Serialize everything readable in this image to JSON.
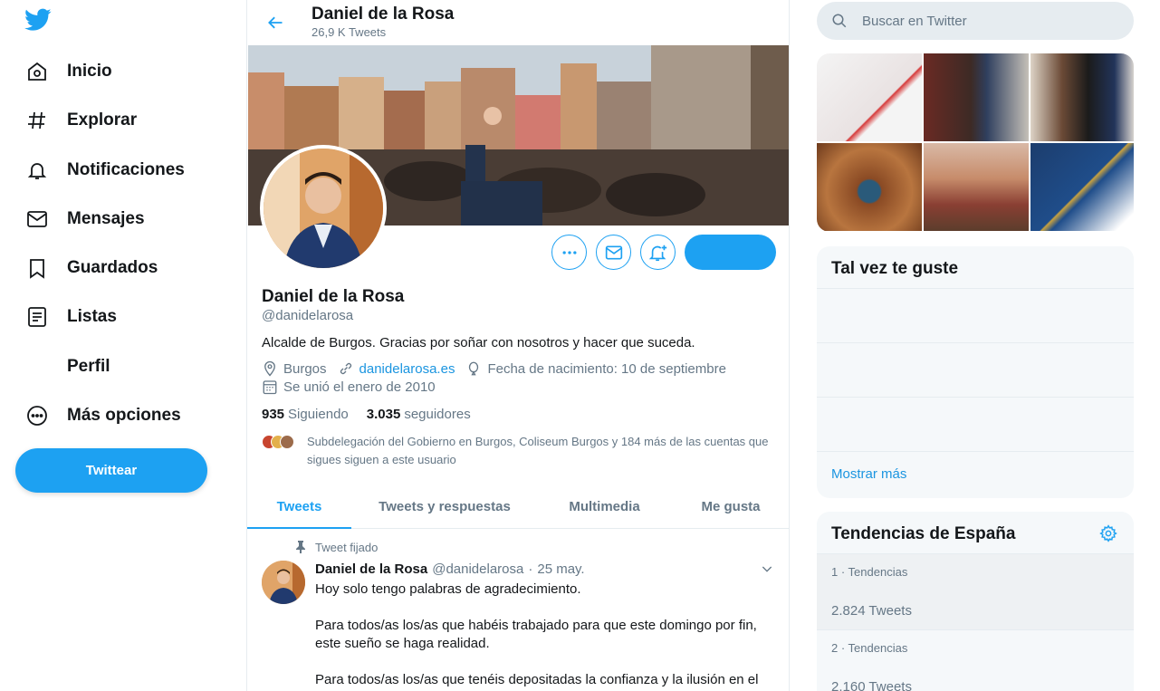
{
  "nav": {
    "items": [
      {
        "label": "Inicio",
        "icon": "home-icon"
      },
      {
        "label": "Explorar",
        "icon": "hashtag-icon"
      },
      {
        "label": "Notificaciones",
        "icon": "bell-icon"
      },
      {
        "label": "Mensajes",
        "icon": "envelope-icon"
      },
      {
        "label": "Guardados",
        "icon": "bookmark-icon"
      },
      {
        "label": "Listas",
        "icon": "list-icon"
      },
      {
        "label": "Perfil",
        "icon": "profile-icon"
      },
      {
        "label": "Más opciones",
        "icon": "more-options-icon"
      }
    ],
    "tweet_button": "Twittear"
  },
  "header": {
    "name": "Daniel de la Rosa",
    "tweet_count": "26,9 K Tweets"
  },
  "profile": {
    "name": "Daniel de la Rosa",
    "handle": "@danidelarosa",
    "bio": "Alcalde de Burgos. Gracias por soñar con nosotros y hacer que suceda.",
    "location": "Burgos",
    "website": "danidelarosa.es",
    "birthday": "Fecha de nacimiento: 10 de septiembre",
    "joined": "Se unió el enero de 2010",
    "following_count": "935",
    "following_label": "Siguiendo",
    "followers_count": "3.035",
    "followers_label": "seguidores",
    "followers_you_know": "Subdelegación del Gobierno en Burgos, Coliseum Burgos y 184 más de las cuentas que sigues siguen a este usuario"
  },
  "tabs": [
    "Tweets",
    "Tweets y respuestas",
    "Multimedia",
    "Me gusta"
  ],
  "tweet": {
    "pinned_label": "Tweet fijado",
    "author": "Daniel de la Rosa",
    "handle": "@danidelarosa",
    "sep": "·",
    "date": "25 may.",
    "paragraphs": [
      "Hoy solo tengo palabras de agradecimiento.",
      "Para todos/as los/as que habéis trabajado para que este domingo por fin, este sueño se haga realidad.",
      "Para todos/as los/as que tenéis depositadas la confianza y la ilusión en el"
    ]
  },
  "search": {
    "placeholder": "Buscar en Twitter"
  },
  "who_to_follow": {
    "title": "Tal vez te guste",
    "show_more": "Mostrar más"
  },
  "trends": {
    "title": "Tendencias de España",
    "items": [
      {
        "meta": "1 · Tendencias",
        "count": "2.824 Tweets"
      },
      {
        "meta": "2 · Tendencias",
        "count": "2.160 Tweets"
      }
    ]
  },
  "colors": {
    "accent": "#1da1f2",
    "text": "#14171a",
    "muted": "#657786",
    "border": "#e6ecf0"
  }
}
